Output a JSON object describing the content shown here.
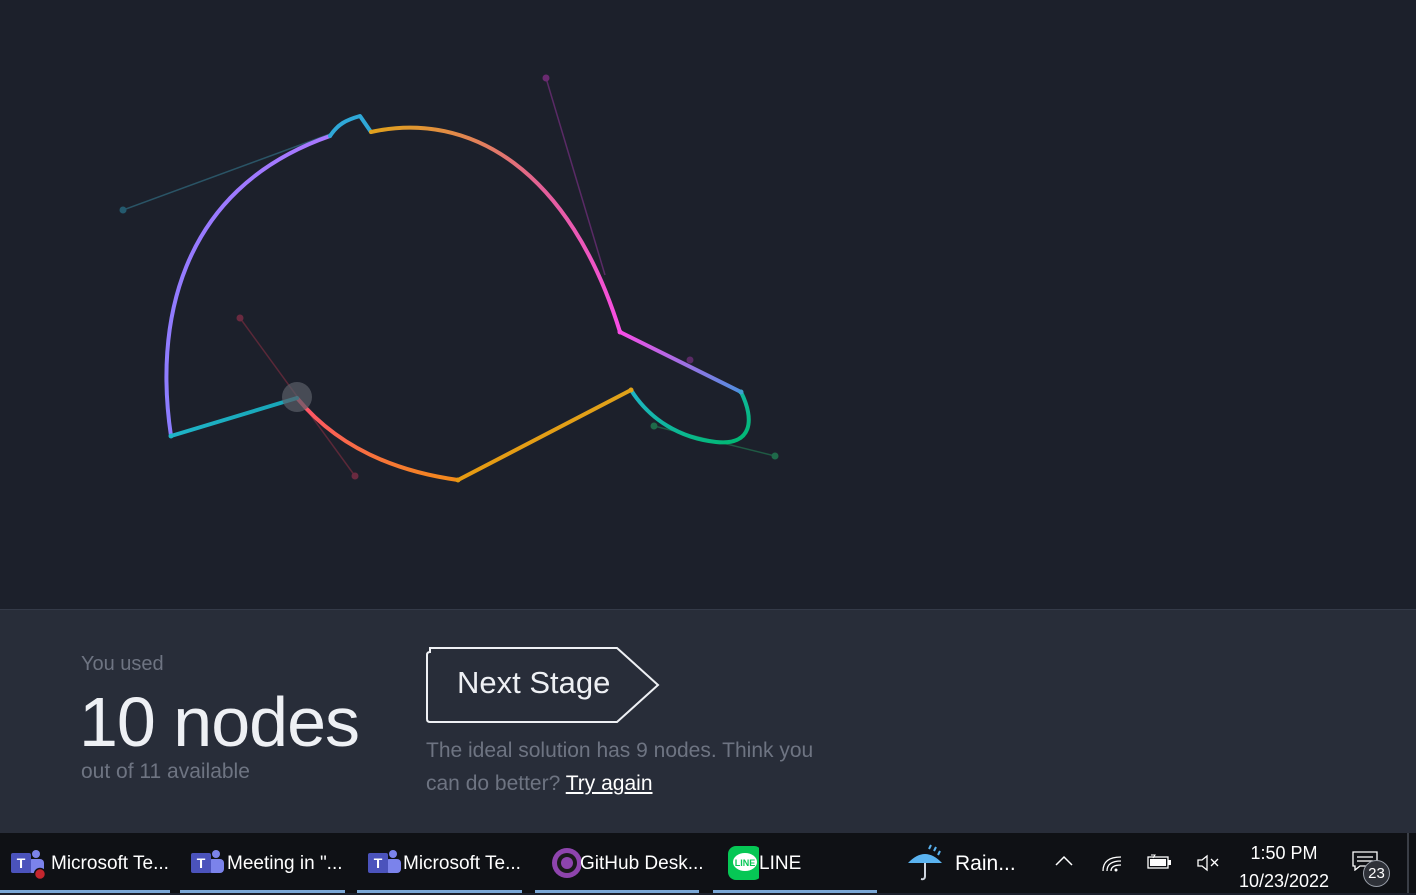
{
  "game": {
    "curve_colors": [
      "#8b7cff",
      "#ff4fd8",
      "#e8a31c",
      "#00b894",
      "#1fb5c8",
      "#ff4f6e"
    ]
  },
  "results": {
    "used_label": "You used",
    "nodes_count": "10 nodes",
    "available": "out of 11 available",
    "next_stage_label": "Next Stage",
    "ideal_text": "The ideal solution has 9 nodes. Think you can do better?",
    "try_again_label": "Try again"
  },
  "taskbar": {
    "apps": [
      {
        "label": "Microsoft Te...",
        "icon": "teams-icon"
      },
      {
        "label": "Meeting in \"...",
        "icon": "teams-icon"
      },
      {
        "label": "Microsoft Te...",
        "icon": "teams-icon"
      },
      {
        "label": "GitHub Desk...",
        "icon": "github-icon"
      },
      {
        "label": "LINE",
        "icon": "line-icon"
      }
    ],
    "weather_label": "Rain...",
    "time": "1:50 PM",
    "date": "10/23/2022",
    "notification_count": "23"
  }
}
